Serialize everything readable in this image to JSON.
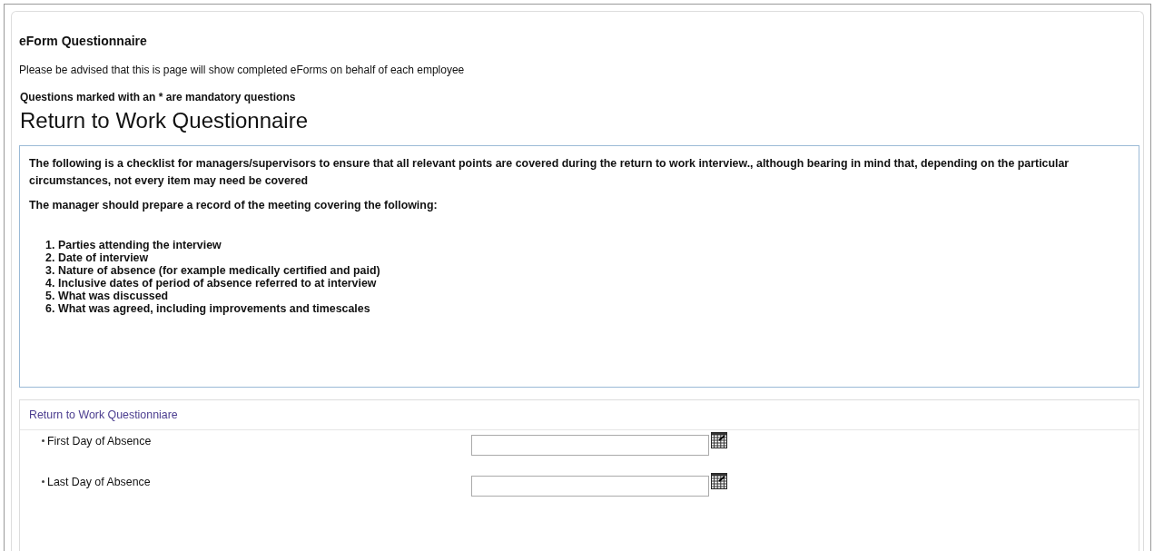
{
  "page_title": "eForm Questionnaire",
  "notice": "Please be advised that this is page will show completed eForms on behalf of each employee",
  "mandatory_note": "Questions marked with an * are mandatory questions",
  "form_title": "Return to Work Questionnaire",
  "info": {
    "intro": "The following is a checklist for managers/supervisors to ensure that all relevant points are covered during the return to work interview., although bearing in mind that, depending on the particular circumstances, not every item may need be covered",
    "lead": "The manager should prepare a record of the meeting covering the following:",
    "items": [
      {
        "number": "1.",
        "text": "Parties attending the interview"
      },
      {
        "number": "2.",
        "text": "Date of interview"
      },
      {
        "number": "3.",
        "text": "Nature of absence (for example medically certified and paid)"
      },
      {
        "number": "4.",
        "text": "Inclusive dates of period of absence referred to at interview"
      },
      {
        "number": "5.",
        "text": "What was discussed"
      },
      {
        "number": "6.",
        "text": "What was agreed, including improvements and timescales"
      }
    ]
  },
  "section": {
    "title": "Return to Work Questionniare",
    "fields": [
      {
        "label": "First Day of Absence",
        "required": true
      },
      {
        "label": "Last Day of Absence",
        "required": true
      }
    ]
  }
}
